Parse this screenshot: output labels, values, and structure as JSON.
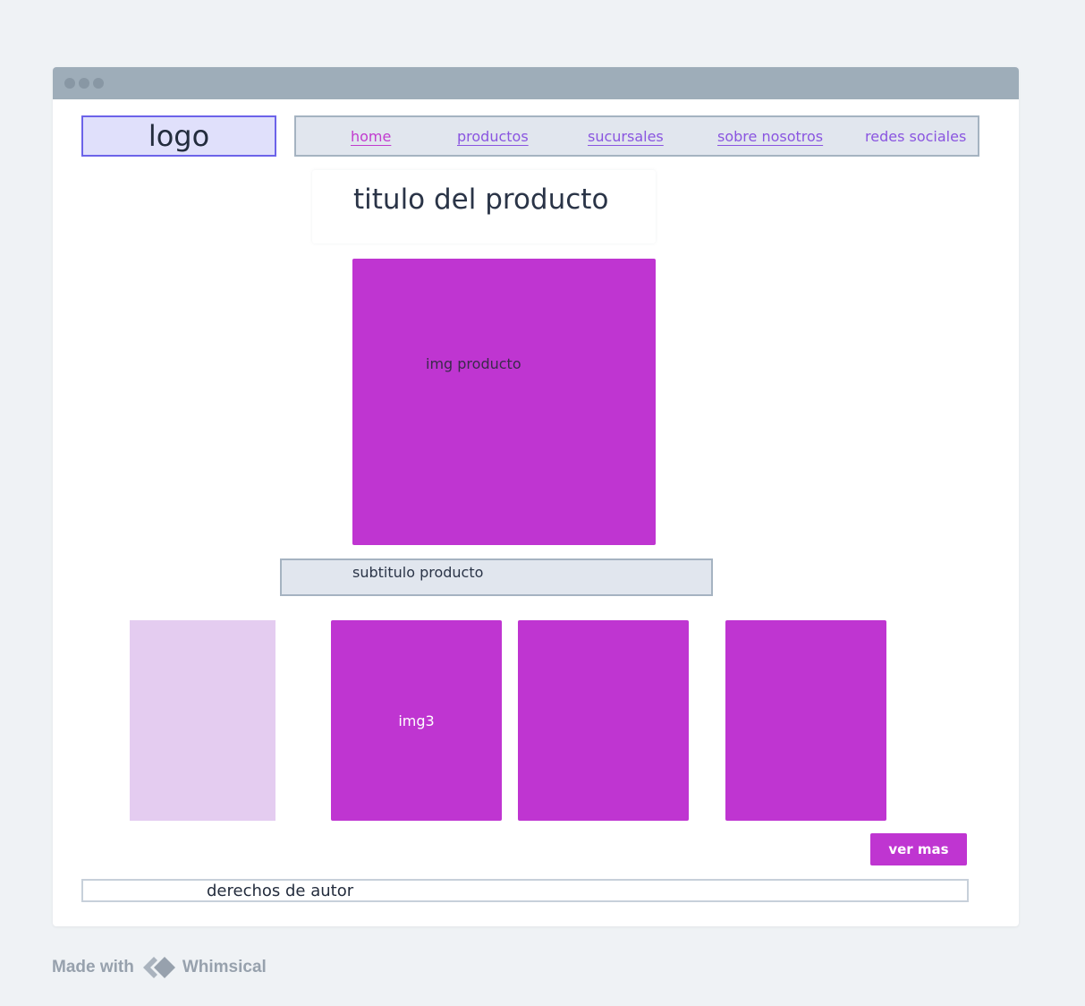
{
  "header": {
    "logo_label": "logo",
    "nav": [
      {
        "label": "home",
        "active": true
      },
      {
        "label": "productos"
      },
      {
        "label": "sucursales"
      },
      {
        "label": "sobre nosotros"
      },
      {
        "label": "redes sociales"
      }
    ]
  },
  "main": {
    "title": "titulo del producto",
    "main_image_label": "img producto",
    "subtitle": "subtitulo producto",
    "thumbnails": [
      {
        "label": ""
      },
      {
        "label": "img3"
      },
      {
        "label": ""
      },
      {
        "label": ""
      }
    ],
    "more_button": "ver mas"
  },
  "footer": {
    "text": "derechos de autor"
  },
  "watermark": {
    "made_with": "Made with",
    "brand": "Whimsical"
  },
  "colors": {
    "accent": "#bf35d1",
    "accent_light": "#e4ccf0",
    "nav_link": "#8a55e0",
    "logo_border": "#6c63e9",
    "page_bg": "#eff2f5",
    "titlebar": "#9eadb9"
  }
}
